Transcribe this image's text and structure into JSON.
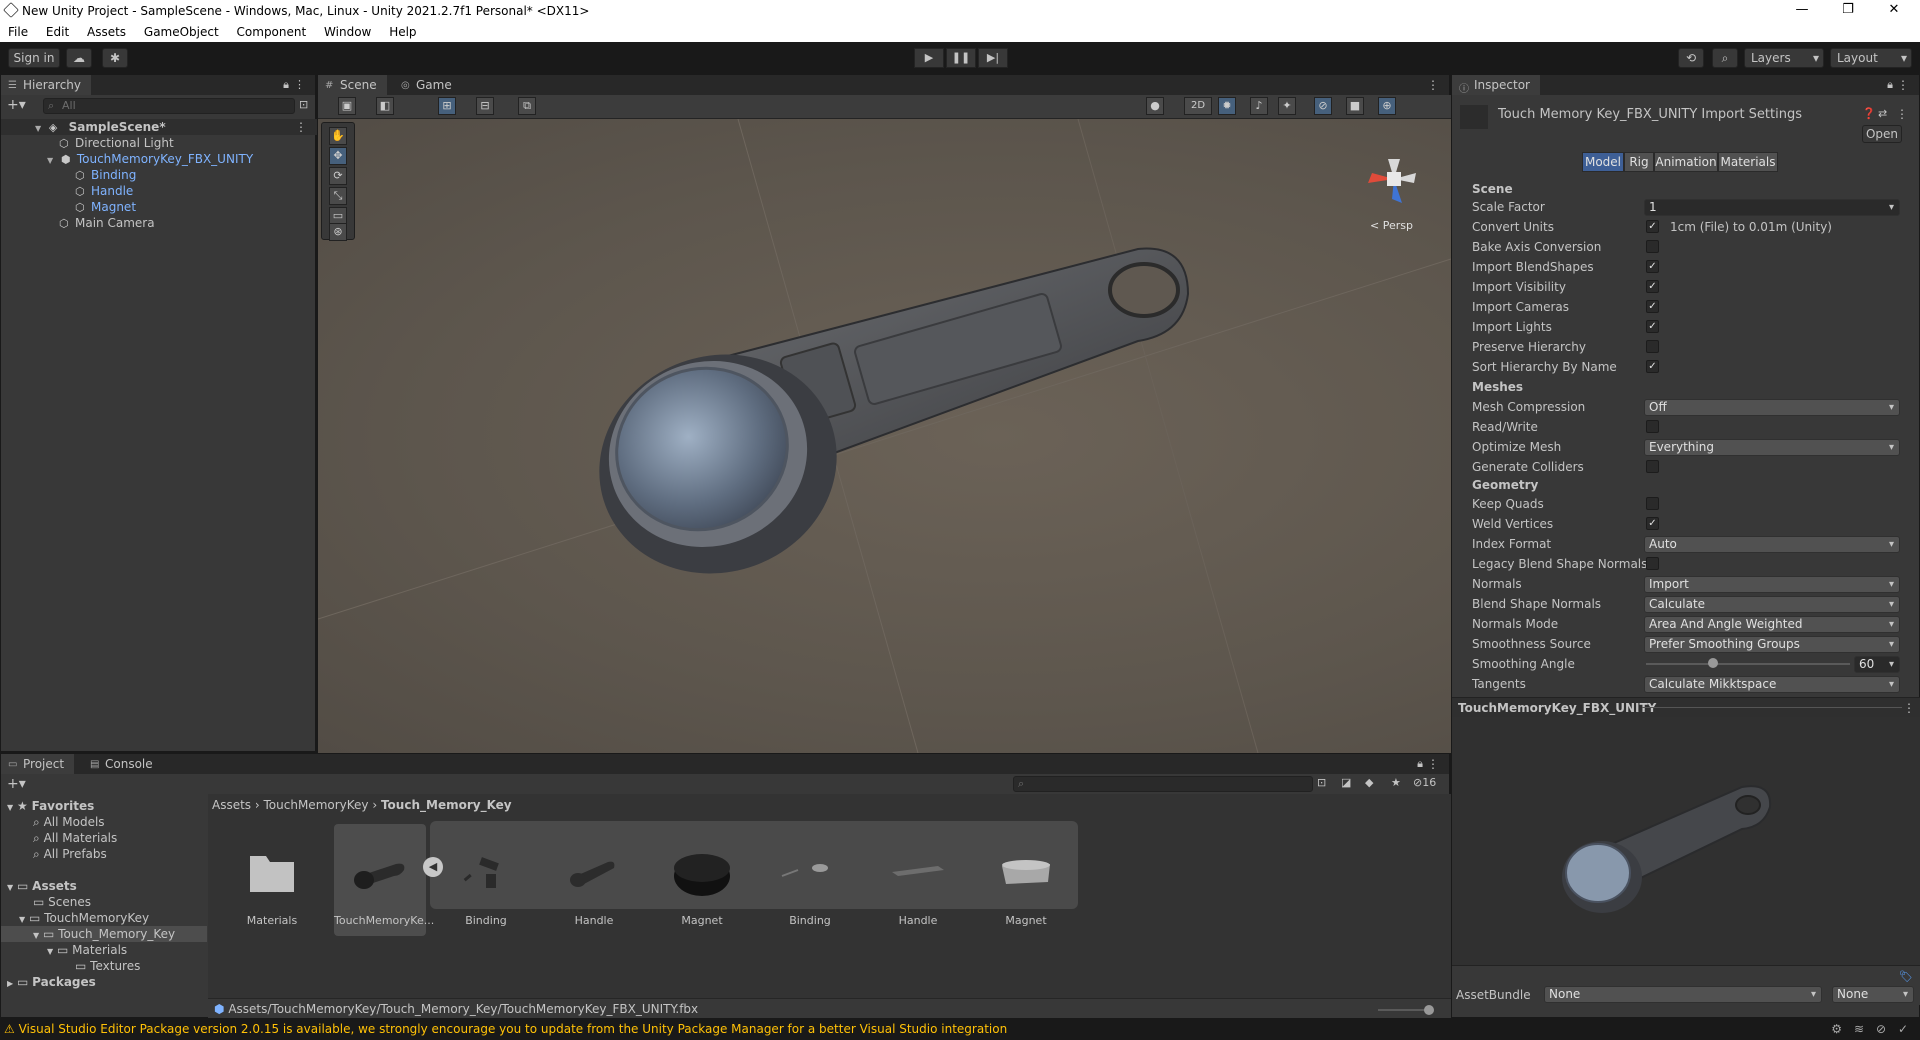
{
  "window": {
    "title": "New Unity Project - SampleScene - Windows, Mac, Linux - Unity 2021.2.7f1 Personal* <DX11>",
    "minimize": "—",
    "maximize": "❐",
    "close": "✕"
  },
  "menu": [
    "File",
    "Edit",
    "Assets",
    "GameObject",
    "Component",
    "Window",
    "Help"
  ],
  "toolbar": {
    "sign_in": "Sign in",
    "layers": "Layers",
    "layout": "Layout"
  },
  "hierarchy": {
    "tab": "Hierarchy",
    "search_placeholder": "All",
    "scene_name": "SampleScene*",
    "items": [
      {
        "label": "Directional Light"
      },
      {
        "label": "TouchMemoryKey_FBX_UNITY"
      },
      {
        "label": "Binding"
      },
      {
        "label": "Handle"
      },
      {
        "label": "Magnet"
      },
      {
        "label": "Main Camera"
      }
    ]
  },
  "scene": {
    "tab_scene": "Scene",
    "tab_game": "Game",
    "mode_2d": "2D",
    "persp_label": "< Persp"
  },
  "inspector": {
    "tab": "Inspector",
    "title": "Touch Memory Key_FBX_UNITY Import Settings",
    "open_button": "Open",
    "tabs": [
      "Model",
      "Rig",
      "Animation",
      "Materials"
    ],
    "section_scene": "Scene",
    "scale_factor_label": "Scale Factor",
    "scale_factor_value": "1",
    "convert_units_label": "Convert Units",
    "convert_units_note": "1cm (File) to 0.01m (Unity)",
    "bake_axis_label": "Bake Axis Conversion",
    "import_blendshapes_label": "Import BlendShapes",
    "import_visibility_label": "Import Visibility",
    "import_cameras_label": "Import Cameras",
    "import_lights_label": "Import Lights",
    "preserve_hierarchy_label": "Preserve Hierarchy",
    "sort_hierarchy_label": "Sort Hierarchy By Name",
    "section_meshes": "Meshes",
    "mesh_compression_label": "Mesh Compression",
    "mesh_compression_value": "Off",
    "read_write_label": "Read/Write",
    "optimize_mesh_label": "Optimize Mesh",
    "optimize_mesh_value": "Everything",
    "generate_colliders_label": "Generate Colliders",
    "section_geometry": "Geometry",
    "keep_quads_label": "Keep Quads",
    "weld_vertices_label": "Weld Vertices",
    "index_format_label": "Index Format",
    "index_format_value": "Auto",
    "legacy_blend_label": "Legacy Blend Shape Normals",
    "normals_label": "Normals",
    "normals_value": "Import",
    "blend_shape_normals_label": "Blend Shape Normals",
    "blend_shape_normals_value": "Calculate",
    "normals_mode_label": "Normals Mode",
    "normals_mode_value": "Area And Angle Weighted",
    "smoothness_source_label": "Smoothness Source",
    "smoothness_source_value": "Prefer Smoothing Groups",
    "smoothing_angle_label": "Smoothing Angle",
    "smoothing_angle_value": "60",
    "smoothing_angle_fraction": 0.33,
    "tangents_label": "Tangents",
    "tangents_value": "Calculate Mikktspace",
    "preview_title": "TouchMemoryKey_FBX_UNITY",
    "assetbundle_label": "AssetBundle",
    "assetbundle_value": "None",
    "assetbundle_variant": "None"
  },
  "project": {
    "tab_project": "Project",
    "tab_console": "Console",
    "hidden_count": "16",
    "favorites": "Favorites",
    "fav_items": [
      "All Models",
      "All Materials",
      "All Prefabs"
    ],
    "assets_root": "Assets",
    "tree": [
      "Scenes",
      "TouchMemoryKey",
      "Touch_Memory_Key",
      "Materials",
      "Textures"
    ],
    "packages": "Packages",
    "breadcrumb": [
      "Assets",
      "TouchMemoryKey",
      "Touch_Memory_Key"
    ],
    "assets": [
      "Materials",
      "TouchMemoryKe...",
      "Binding",
      "Handle",
      "Magnet",
      "Binding",
      "Handle",
      "Magnet"
    ],
    "path": "Assets/TouchMemoryKey/Touch_Memory_Key/TouchMemoryKey_FBX_UNITY.fbx"
  },
  "status": {
    "message": "Visual Studio Editor Package version 2.0.15 is available, we strongly encourage you to update from the Unity Package Manager for a better Visual Studio integration"
  }
}
